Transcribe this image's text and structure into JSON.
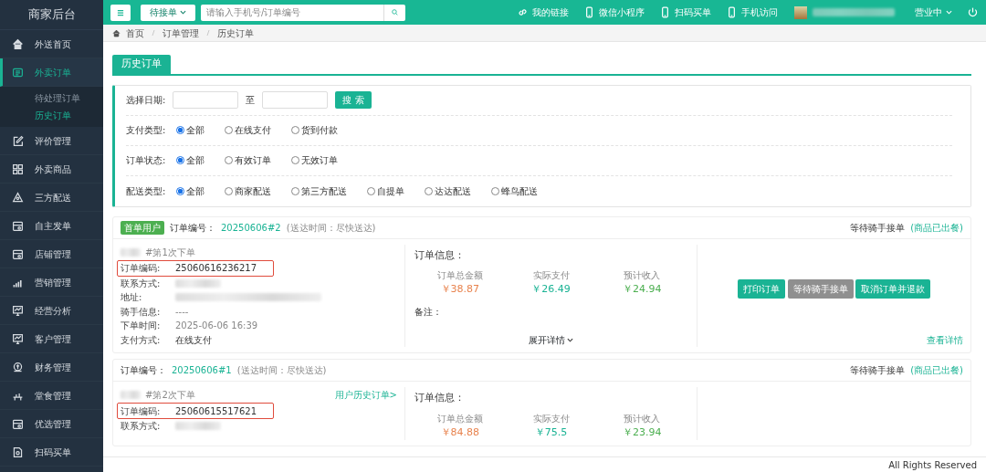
{
  "sidebar": {
    "title": "商家后台",
    "items": [
      {
        "label": "外送首页",
        "selected": false
      },
      {
        "label": "外卖订单",
        "selected": true,
        "children": [
          {
            "label": "待处理订单",
            "selected": false
          },
          {
            "label": "历史订单",
            "selected": true
          }
        ]
      },
      {
        "label": "评价管理",
        "selected": false
      },
      {
        "label": "外卖商品",
        "selected": false
      },
      {
        "label": "三方配送",
        "selected": false
      },
      {
        "label": "自主发单",
        "selected": false
      },
      {
        "label": "店铺管理",
        "selected": false
      },
      {
        "label": "营销管理",
        "selected": false
      },
      {
        "label": "经营分析",
        "selected": false
      },
      {
        "label": "客户管理",
        "selected": false
      },
      {
        "label": "财务管理",
        "selected": false
      },
      {
        "label": "堂食管理",
        "selected": false
      },
      {
        "label": "优选管理",
        "selected": false
      },
      {
        "label": "扫码买单",
        "selected": false
      }
    ]
  },
  "topbar": {
    "status_filter": "待接单",
    "search_placeholder": "请输入手机号/订单编号",
    "links": [
      {
        "label": "我的链接"
      },
      {
        "label": "微信小程序"
      },
      {
        "label": "扫码买单"
      },
      {
        "label": "手机访问"
      }
    ],
    "business_status": "营业中"
  },
  "breadcrumb": [
    "首页",
    "订单管理",
    "历史订单"
  ],
  "tab": "历史订单",
  "filters": {
    "date_label": "选择日期:",
    "date_separator": "至",
    "search_button": "搜 索",
    "radio_groups": [
      {
        "label": "支付类型:",
        "options": [
          {
            "label": "全部",
            "selected": true
          },
          {
            "label": "在线支付",
            "selected": false
          },
          {
            "label": "货到付款",
            "selected": false
          }
        ]
      },
      {
        "label": "订单状态:",
        "options": [
          {
            "label": "全部",
            "selected": true
          },
          {
            "label": "有效订单",
            "selected": false
          },
          {
            "label": "无效订单",
            "selected": false
          }
        ]
      },
      {
        "label": "配送类型:",
        "options": [
          {
            "label": "全部",
            "selected": true
          },
          {
            "label": "商家配送",
            "selected": false
          },
          {
            "label": "第三方配送",
            "selected": false
          },
          {
            "label": "自提单",
            "selected": false
          },
          {
            "label": "达达配送",
            "selected": false
          },
          {
            "label": "蜂鸟配送",
            "selected": false
          }
        ]
      }
    ]
  },
  "orders": [
    {
      "badge": "首单用户",
      "number_label": "订单编号：",
      "number": "20250606#2",
      "delivery": "(送达时间：尽快送达)",
      "status": "等待骑手接单",
      "status_note": "(商品已出餐)",
      "order_count": "#第1次下单",
      "fields": [
        {
          "label": "订单编码:",
          "value": "25060616236217",
          "highlighted": true,
          "redacted": false,
          "muted": false
        },
        {
          "label": "联系方式:",
          "redacted": true,
          "highlighted": false
        },
        {
          "label": "地址:",
          "redacted": true,
          "highlighted": false
        },
        {
          "label": "骑手信息:",
          "value": "----",
          "redacted": false,
          "highlighted": false,
          "muted": true
        },
        {
          "label": "下单时间:",
          "value": "2025-06-06 16:39",
          "redacted": false,
          "highlighted": false,
          "muted": true
        },
        {
          "label": "支付方式:",
          "value": "在线支付",
          "redacted": false,
          "highlighted": false,
          "muted": false
        }
      ],
      "info_title": "订单信息：",
      "stats": [
        {
          "label": "订单总金额",
          "value": "￥38.87"
        },
        {
          "label": "实际支付",
          "value": "￥26.49"
        },
        {
          "label": "预计收入",
          "value": "￥24.94"
        }
      ],
      "remark_label": "备注：",
      "expand": "展开详情",
      "buttons": [
        {
          "label": "打印订单",
          "disabled": false
        },
        {
          "label": "等待骑手接单",
          "disabled": true
        },
        {
          "label": "取消订单并退款",
          "disabled": false
        }
      ],
      "details_link": "查看详情"
    },
    {
      "number_label": "订单编号：",
      "number": "20250606#1",
      "delivery": "(送达时间：尽快送达)",
      "status": "等待骑手接单",
      "status_note": "(商品已出餐)",
      "order_count": "#第2次下单",
      "history_link": "用户历史订单>",
      "fields": [
        {
          "label": "订单编码:",
          "value": "25060615517621",
          "highlighted": true,
          "redacted": false,
          "muted": false
        },
        {
          "label": "联系方式:",
          "redacted": true,
          "highlighted": false
        }
      ],
      "info_title": "订单信息：",
      "stats": [
        {
          "label": "订单总金额",
          "value": "￥84.88"
        },
        {
          "label": "实际支付",
          "value": "￥75.5"
        },
        {
          "label": "预计收入",
          "value": "￥23.94"
        }
      ]
    }
  ],
  "footer": "All Rights Reserved"
}
